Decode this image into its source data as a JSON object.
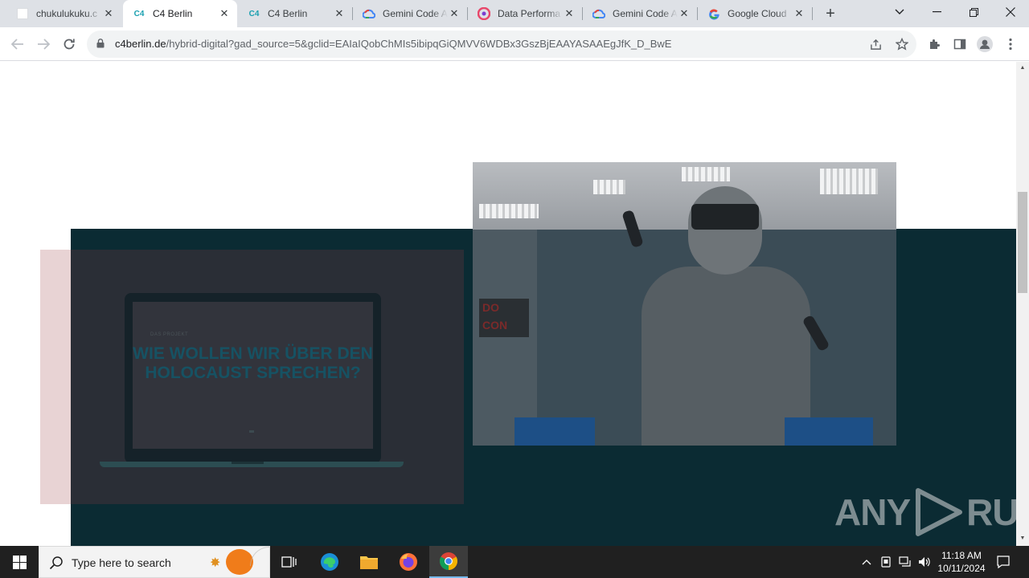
{
  "browser": {
    "tabs": [
      {
        "title": "chukulukuku.c",
        "favicon": "blank-page-icon",
        "active": false
      },
      {
        "title": "C4 Berlin",
        "favicon": "c4-logo-icon",
        "active": true
      },
      {
        "title": "C4 Berlin",
        "favicon": "c4-logo-icon",
        "active": false
      },
      {
        "title": "Gemini Code A",
        "favicon": "google-cloud-icon",
        "active": false
      },
      {
        "title": "Data Performa",
        "favicon": "data-performance-icon",
        "active": false
      },
      {
        "title": "Gemini Code A",
        "favicon": "google-cloud-icon",
        "active": false
      },
      {
        "title": "Google Cloud",
        "favicon": "google-g-icon",
        "active": false
      }
    ],
    "favicon_text": "C4",
    "close_glyph": "✕",
    "new_tab_glyph": "+",
    "url_host": "c4berlin.de",
    "url_path": "/hybrid-digital?gad_source=5&gclid=EAIaIQobChMIs5ibipqGiQMVV6WDBx3GszBjEAAYASAAEgJfK_D_BwE"
  },
  "page": {
    "laptop_small_text": "DAS PROJEKT",
    "laptop_heading": "WIE WOLLEN WIR ÜBER DEN HOLOCAUST SPRECHEN?",
    "photo_sign": "DO\nCON",
    "watermark": {
      "left": "ANY",
      "right": "RUN"
    }
  },
  "taskbar": {
    "search_placeholder": "Type here to search",
    "time": "11:18 AM",
    "date": "10/11/2024"
  },
  "colors": {
    "dark_panel": "#0b2b33",
    "pink_block": "#e8d3d4",
    "chrome_tabstrip": "#dee1e6",
    "taskbar": "#202020"
  }
}
